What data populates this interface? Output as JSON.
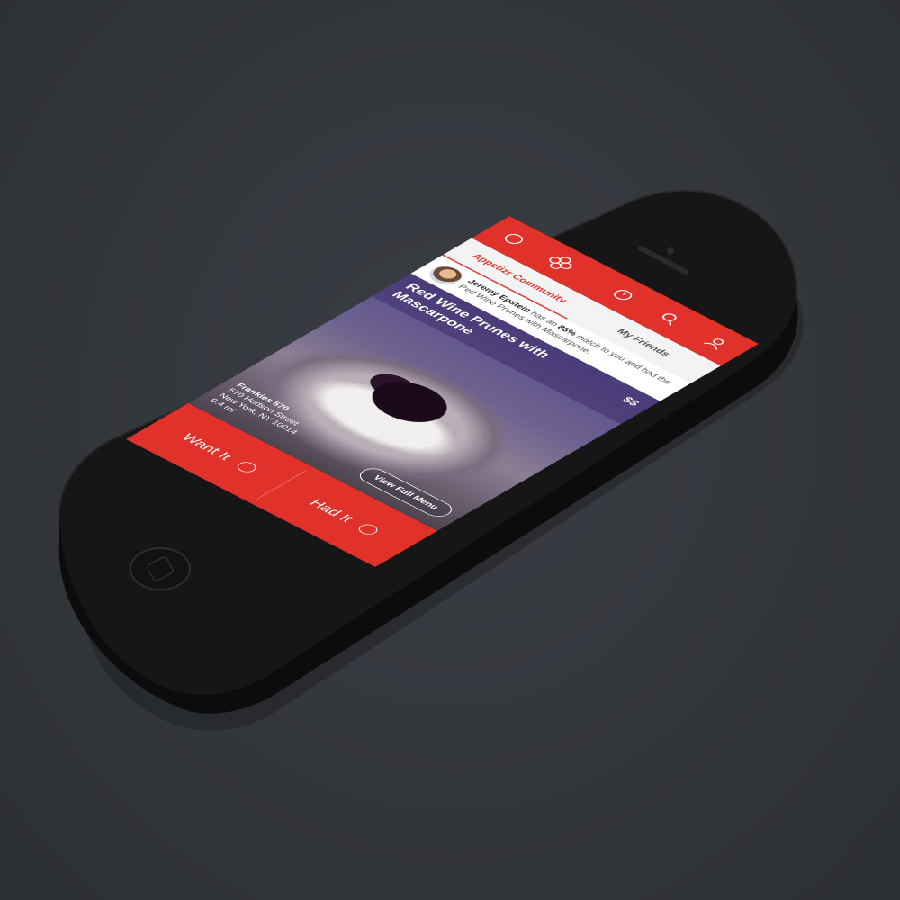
{
  "nav": {
    "icons": [
      "home-icon",
      "appetizr-logo-icon",
      "clock-icon",
      "search-icon",
      "profile-icon"
    ],
    "brand_color": "#e0322a"
  },
  "tabs": [
    {
      "label": "Appetizr Community",
      "active": true
    },
    {
      "label": "My Friends",
      "active": false
    }
  ],
  "activity": {
    "user": "Jeremy Epstein",
    "text_before": "has an",
    "match": "86%",
    "text_after": "match to you and had the Red Wine Prunes with Mascarpone."
  },
  "dish": {
    "title": "Red Wine Prunes with Mascarpone",
    "price": "$$"
  },
  "venue": {
    "name": "Frankies 570",
    "street": "570 Hudson Street",
    "city": "New York, NY 10014",
    "distance": "0.4 mi"
  },
  "menu_button": "View Full Menu",
  "actions": [
    {
      "label": "Want It"
    },
    {
      "label": "Had It"
    }
  ]
}
